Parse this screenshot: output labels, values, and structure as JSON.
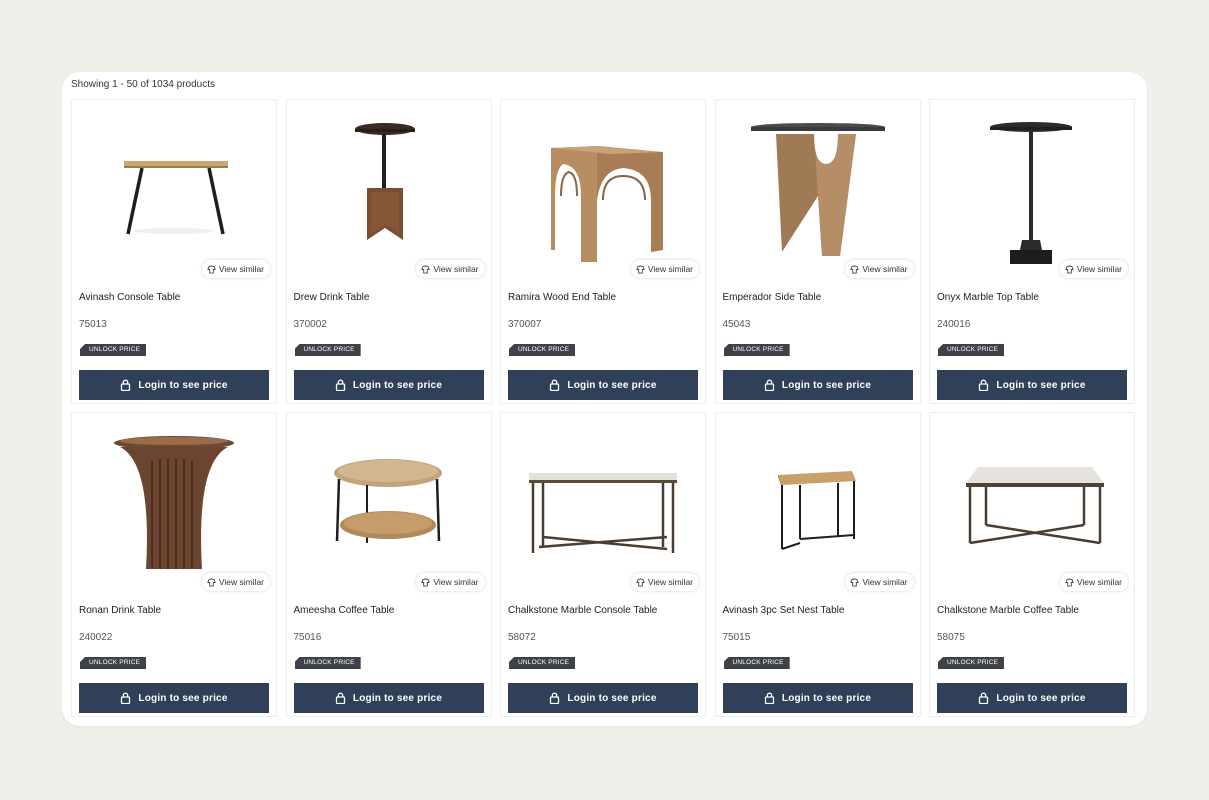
{
  "listing": {
    "count_text": "Showing 1 - 50 of 1034 products",
    "view_similar_label": "View similar",
    "unlock_label": "UNLOCK PRICE",
    "login_label": "Login to see price"
  },
  "products": [
    {
      "name": "Avinash Console Table",
      "sku": "75013",
      "icon": "console-table-image"
    },
    {
      "name": "Drew Drink Table",
      "sku": "370002",
      "icon": "drink-table-image"
    },
    {
      "name": "Ramira Wood End Table",
      "sku": "370007",
      "icon": "wood-end-table-image"
    },
    {
      "name": "Emperador Side Table",
      "sku": "45043",
      "icon": "side-table-image"
    },
    {
      "name": "Onyx Marble Top Table",
      "sku": "240016",
      "icon": "pedestal-table-image"
    },
    {
      "name": "Ronan Drink Table",
      "sku": "240022",
      "icon": "fluted-drink-table-image"
    },
    {
      "name": "Ameesha Coffee Table",
      "sku": "75016",
      "icon": "round-coffee-table-image"
    },
    {
      "name": "Chalkstone Marble Console Table",
      "sku": "58072",
      "icon": "marble-console-table-image"
    },
    {
      "name": "Avinash 3pc Set Nest Table",
      "sku": "75015",
      "icon": "nest-table-image"
    },
    {
      "name": "Chalkstone Marble Coffee Table",
      "sku": "58075",
      "icon": "marble-coffee-table-image"
    }
  ],
  "colors": {
    "page_background": "#f0f0ea",
    "button": "#2f4058",
    "unlock_badge": "#3e4148"
  }
}
